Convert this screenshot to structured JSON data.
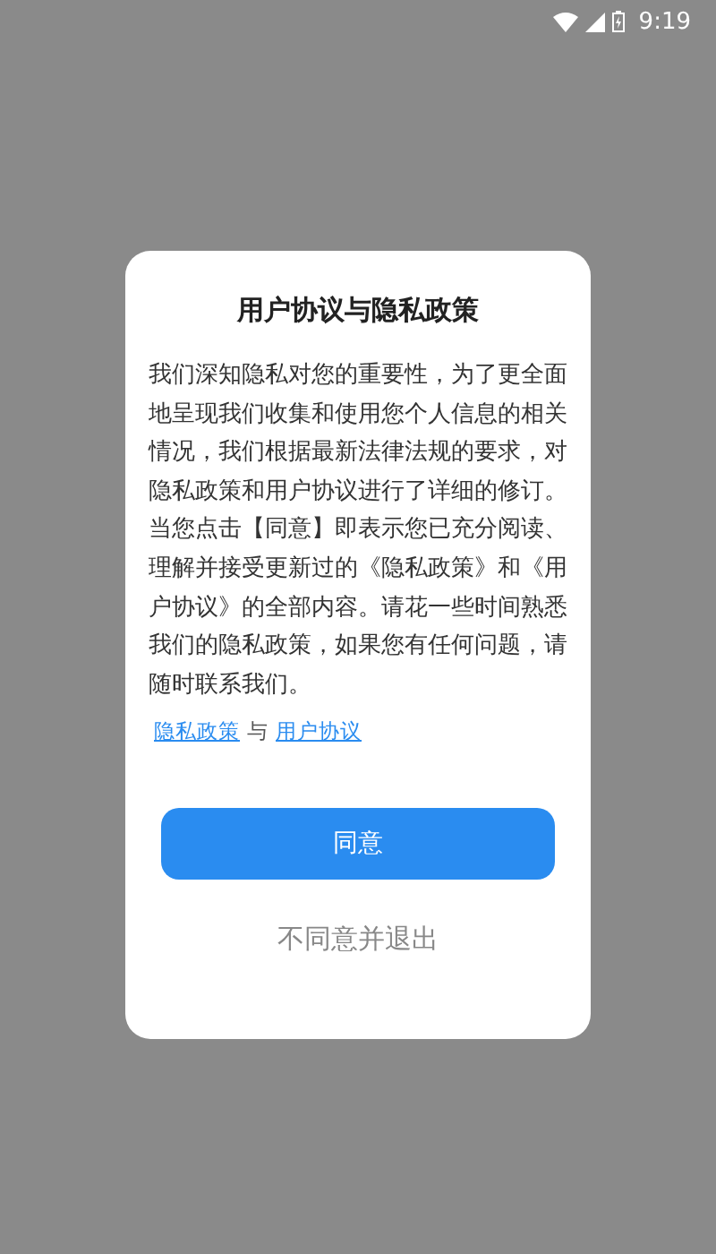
{
  "status_bar": {
    "time": "9:19"
  },
  "dialog": {
    "title": "用户协议与隐私政策",
    "body": "我们深知隐私对您的重要性，为了更全面地呈现我们收集和使用您个人信息的相关情况，我们根据最新法律法规的要求，对隐私政策和用户协议进行了详细的修订。当您点击【同意】即表示您已充分阅读、理解并接受更新过的《隐私政策》和《用户协议》的全部内容。请花一些时间熟悉我们的隐私政策，如果您有任何问题，请随时联系我们。",
    "links": [
      {
        "kind": "link",
        "text": "隐私政策"
      },
      {
        "kind": "text",
        "text": "与"
      },
      {
        "kind": "link",
        "text": "用户协议"
      }
    ],
    "buttons": [
      {
        "kind": "primary",
        "label": "同意"
      },
      {
        "kind": "plain",
        "label": "不同意并退出"
      }
    ]
  }
}
